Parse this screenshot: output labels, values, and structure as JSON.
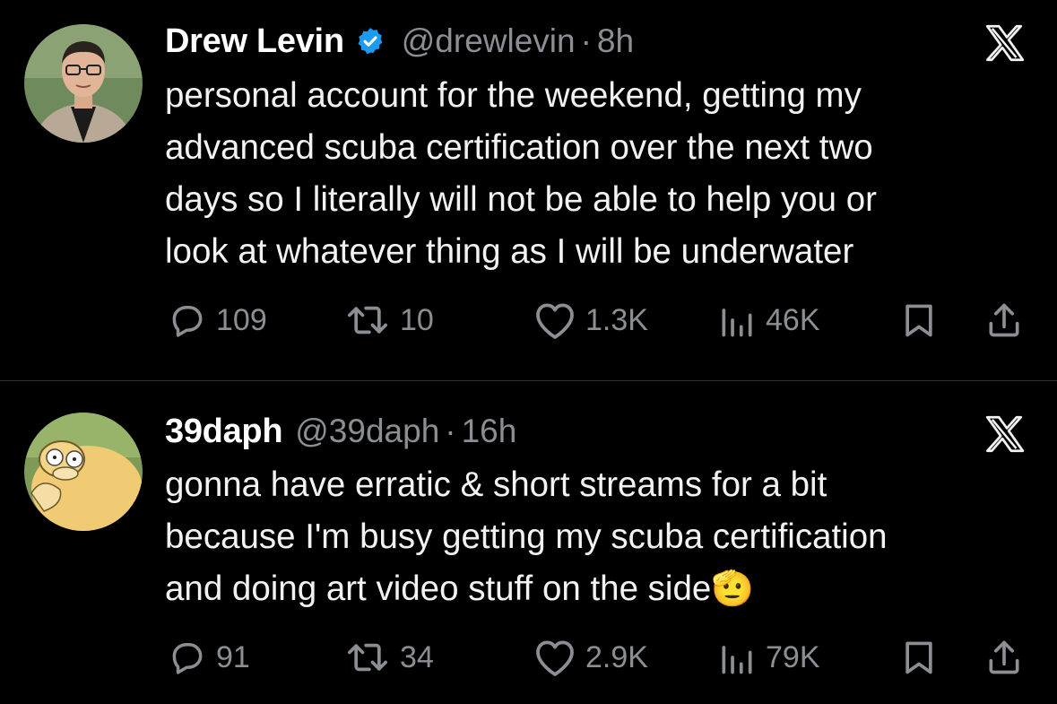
{
  "tweets": [
    {
      "name": "Drew Levin",
      "verified": true,
      "handle": "@drewlevin",
      "separator": "·",
      "time": "8h",
      "text_lines": [
        "personal account for the weekend, getting my",
        "advanced scuba certification over the next two",
        "days so I literally will not be able to help you or",
        "look at whatever thing as I will be underwater"
      ],
      "stats": {
        "replies": "109",
        "retweets": "10",
        "likes": "1.3K",
        "views": "46K"
      }
    },
    {
      "name": "39daph",
      "verified": false,
      "handle": "@39daph",
      "separator": "·",
      "time": "16h",
      "text_lines": [
        "gonna have erratic & short streams for a bit",
        "because I'm busy getting my scuba certification",
        "and doing art video stuff on the side"
      ],
      "emoji": "🫡",
      "stats": {
        "replies": "91",
        "retweets": "34",
        "likes": "2.9K",
        "views": "79K"
      }
    }
  ],
  "colors": {
    "background": "#000000",
    "text": "#e7e9ea",
    "muted": "#8b8f94",
    "verified": "#1d9bf0",
    "divider": "#2f3336"
  },
  "icons": [
    "reply-icon",
    "retweet-icon",
    "like-icon",
    "views-icon",
    "bookmark-icon",
    "share-icon",
    "x-logo-icon",
    "verified-badge-icon"
  ]
}
